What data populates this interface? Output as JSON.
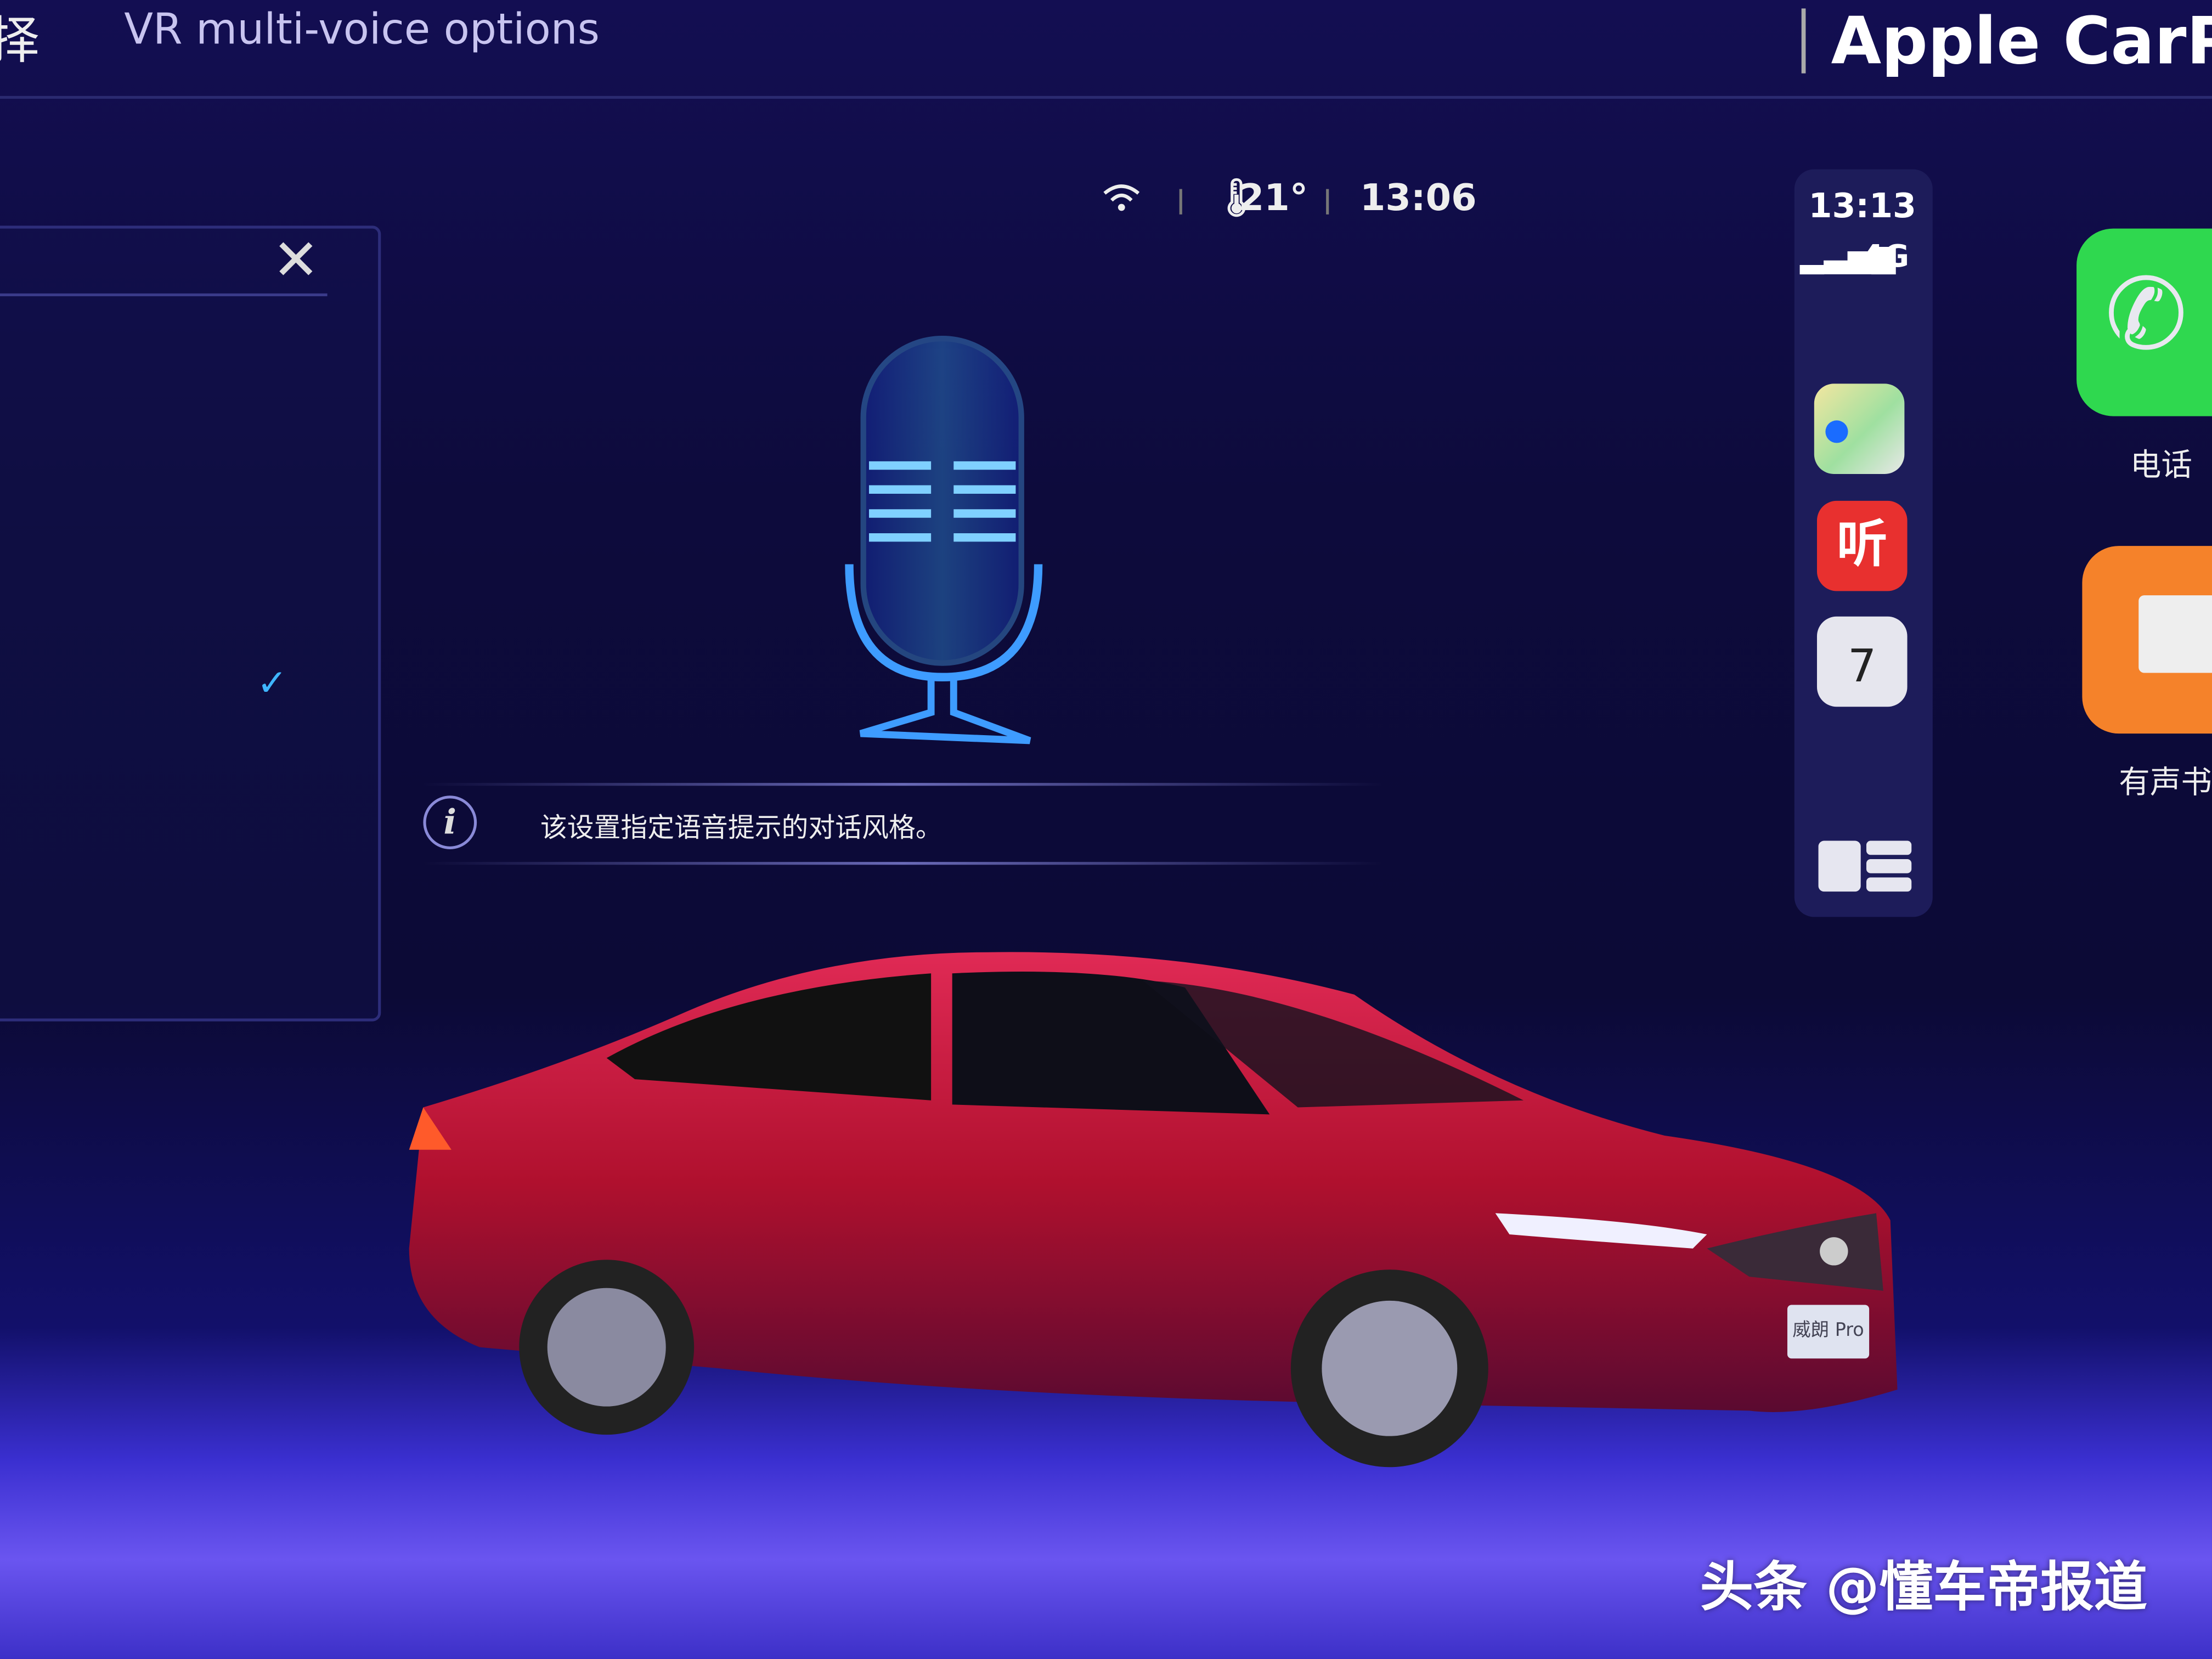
{
  "screen": {
    "header": {
      "selection_char": "择",
      "title": "VR multi-voice options",
      "carplay_title": "Apple CarPlay"
    },
    "status_bar": {
      "wifi_icon": "wifi-icon",
      "temperature": "21°",
      "time": "13:06"
    },
    "info": {
      "icon": "info-icon",
      "text": "该设置指定语音提示的对话风格。"
    },
    "panel": {
      "close_icon": "close-icon",
      "check_icon": "checkmark-icon"
    },
    "carplay": {
      "time": "13:13",
      "network": "4G",
      "dock_apps": [
        "maps",
        "ximalaya-listen",
        "calendar"
      ],
      "listen_app_label": "听",
      "calendar_day": "7",
      "apps": [
        {
          "label": "电话",
          "color": "#2fd84f"
        },
        {
          "label": "有声书",
          "color": "#f5822a"
        }
      ]
    }
  },
  "car": {
    "plate": "威朗 Pro",
    "color": "#c8123a"
  },
  "watermark": "头条 @懂车帝报道"
}
